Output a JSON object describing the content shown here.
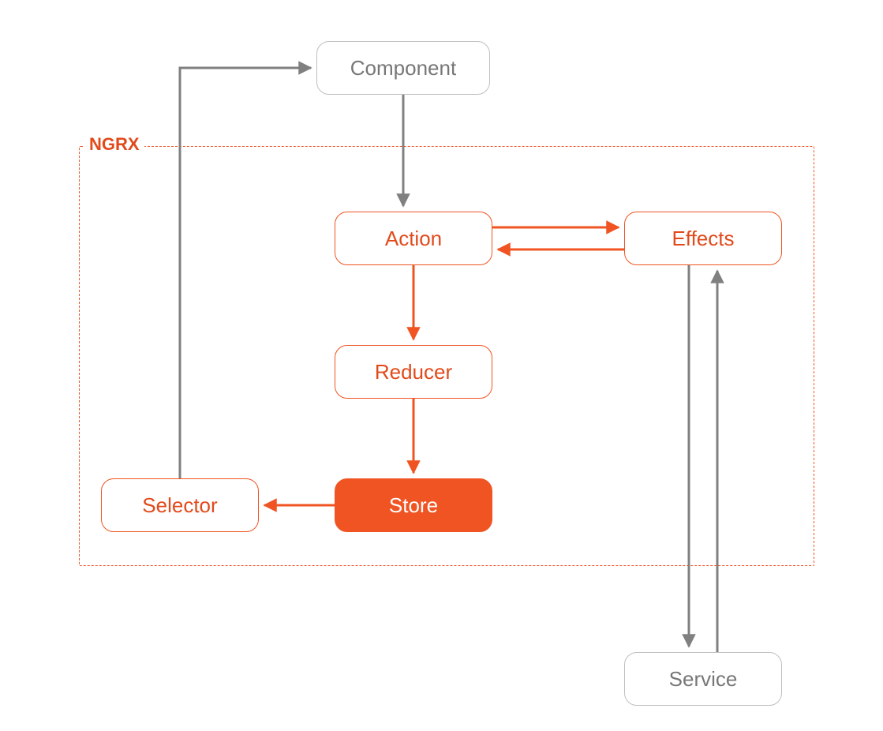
{
  "diagram": {
    "container_label": "NGRX",
    "colors": {
      "orange": "#f05423",
      "orange_text": "#e24a1b",
      "gray_stroke": "#808080",
      "gray_text": "#777777",
      "gray_border": "#bfbfbf"
    },
    "nodes": {
      "component": {
        "label": "Component"
      },
      "action": {
        "label": "Action"
      },
      "effects": {
        "label": "Effects"
      },
      "reducer": {
        "label": "Reducer"
      },
      "store": {
        "label": "Store"
      },
      "selector": {
        "label": "Selector"
      },
      "service": {
        "label": "Service"
      }
    },
    "edges": [
      {
        "from": "component",
        "to": "action",
        "color": "gray"
      },
      {
        "from": "action",
        "to": "reducer",
        "color": "orange"
      },
      {
        "from": "reducer",
        "to": "store",
        "color": "orange"
      },
      {
        "from": "store",
        "to": "selector",
        "color": "orange"
      },
      {
        "from": "selector",
        "to": "component",
        "color": "gray"
      },
      {
        "from": "action",
        "to": "effects",
        "color": "orange"
      },
      {
        "from": "effects",
        "to": "action",
        "color": "orange"
      },
      {
        "from": "effects",
        "to": "service",
        "color": "gray"
      },
      {
        "from": "service",
        "to": "effects",
        "color": "gray"
      }
    ]
  }
}
